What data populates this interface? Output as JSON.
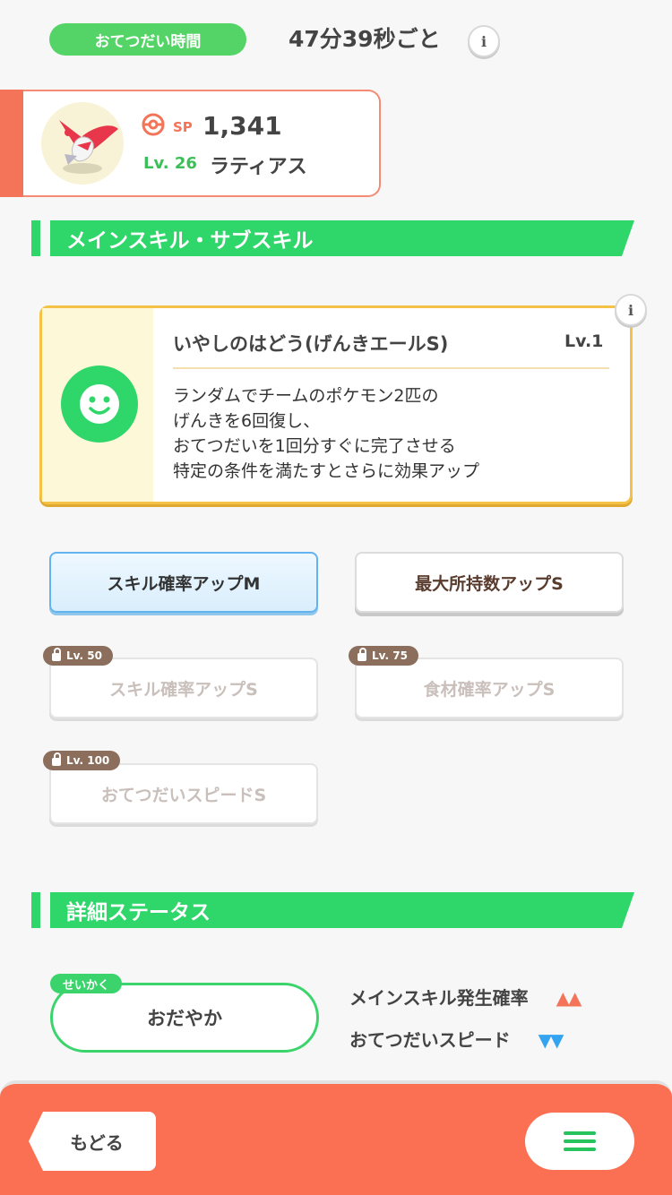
{
  "header": {
    "help_label": "おてつだい時間",
    "help_time": "47分39秒ごと",
    "info_icon": "i"
  },
  "pokemon": {
    "sp_label": "SP",
    "sp_value": "1,341",
    "level": "Lv. 26",
    "name": "ラティアス"
  },
  "sections": {
    "skills_title": "メインスキル・サブスキル",
    "status_title": "詳細ステータス"
  },
  "main_skill": {
    "name": "いやしのはどう(げんきエールS)",
    "level": "Lv.1",
    "description": [
      "ランダムでチームのポケモン2匹の",
      "げんきを6回復し、",
      "おてつだいを1回分すぐに完了させる",
      "特定の条件を満たすとさらに効果アップ"
    ]
  },
  "sub_skills": [
    {
      "label": "スキル確率アップM",
      "state": "active"
    },
    {
      "label": "最大所持数アップS",
      "state": "normal"
    },
    {
      "label": "スキル確率アップS",
      "state": "locked",
      "unlock": "Lv. 50"
    },
    {
      "label": "食材確率アップS",
      "state": "locked",
      "unlock": "Lv. 75"
    },
    {
      "label": "おてつだいスピードS",
      "state": "locked",
      "unlock": "Lv. 100"
    }
  ],
  "status": {
    "nature_tag": "せいかく",
    "nature": "おだやか",
    "up_stat": "メインスキル発生確率",
    "up_arrows": "▲▲",
    "down_stat": "おてつだいスピード",
    "down_arrows": "▼▼"
  },
  "footer": {
    "back_label": "もどる"
  },
  "colors": {
    "accent_green": "#2fd66a",
    "accent_orange": "#fb7052",
    "skill_border": "#f4c247",
    "up_arrow": "#f37459",
    "down_arrow": "#34a4f0"
  }
}
